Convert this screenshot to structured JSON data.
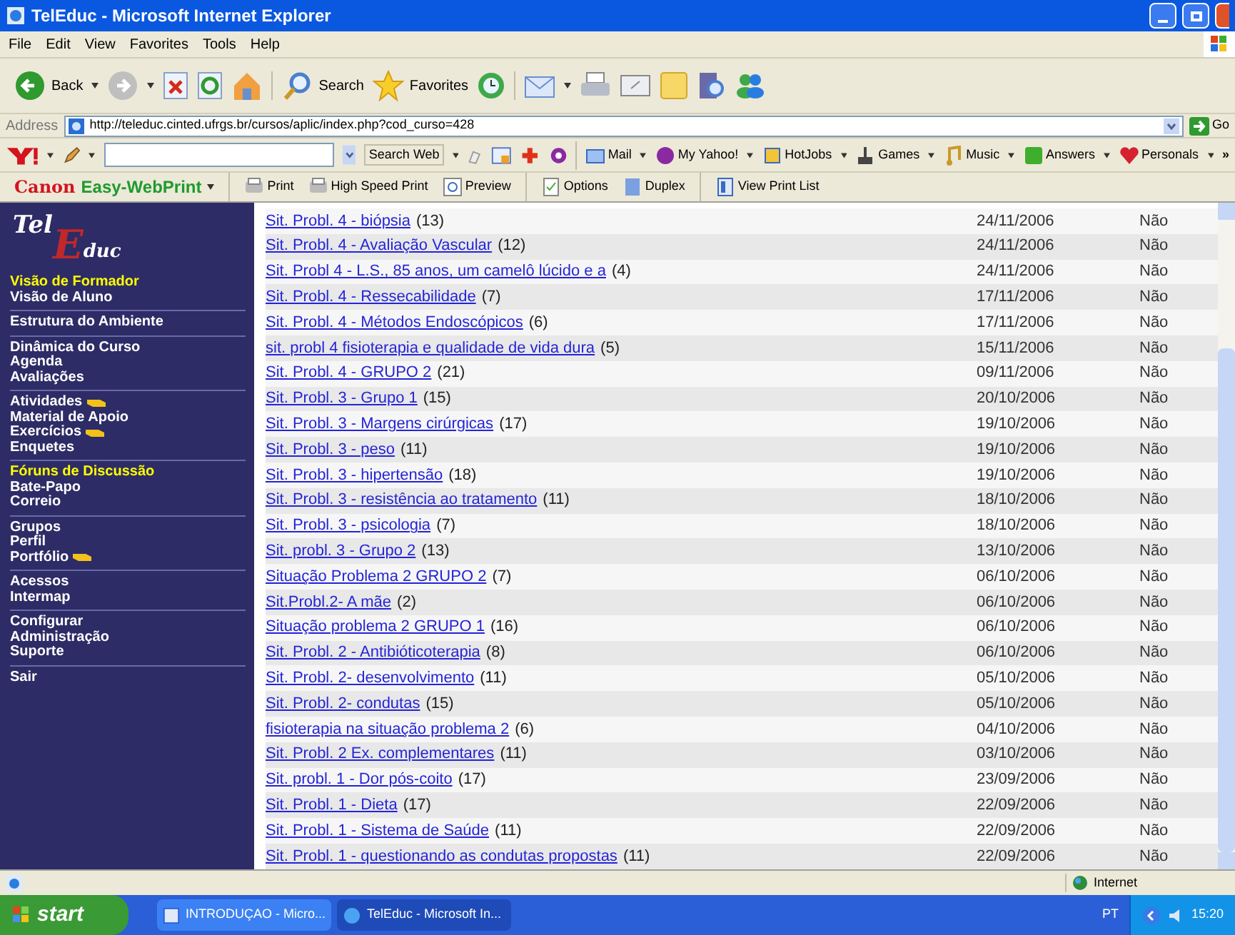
{
  "window": {
    "title": "TelEduc - Microsoft Internet Explorer"
  },
  "menu": [
    "File",
    "Edit",
    "View",
    "Favorites",
    "Tools",
    "Help"
  ],
  "toolbar": {
    "back": "Back",
    "search": "Search",
    "favorites": "Favorites"
  },
  "address": {
    "label": "Address",
    "url": "http://teleduc.cinted.ufrgs.br/cursos/aplic/index.php?cod_curso=428",
    "go": "Go"
  },
  "yahoo_bar": {
    "search_button": "Search Web",
    "items": [
      "Mail",
      "My Yahoo!",
      "HotJobs",
      "Games",
      "Music",
      "Answers",
      "Personals"
    ],
    "more": "»"
  },
  "print_bar": {
    "brand": "Canon",
    "product": "Easy-WebPrint",
    "items": [
      "Print",
      "High Speed Print",
      "Preview",
      "Options",
      "Duplex",
      "View Print List"
    ]
  },
  "sidebar": {
    "logo": [
      "Tel",
      "E",
      "duc"
    ],
    "groups": [
      [
        {
          "label": "Visão de Formador",
          "highlighted": true,
          "pointer": false
        },
        {
          "label": "Visão de Aluno",
          "highlighted": false,
          "pointer": false
        }
      ],
      [
        {
          "label": "Estrutura do Ambiente",
          "highlighted": false,
          "pointer": false
        }
      ],
      [
        {
          "label": "Dinâmica do Curso",
          "highlighted": false,
          "pointer": false
        },
        {
          "label": "Agenda",
          "highlighted": false,
          "pointer": false
        },
        {
          "label": "Avaliações",
          "highlighted": false,
          "pointer": false
        }
      ],
      [
        {
          "label": "Atividades",
          "highlighted": false,
          "pointer": true
        },
        {
          "label": "Material de Apoio",
          "highlighted": false,
          "pointer": false
        },
        {
          "label": "Exercícios",
          "highlighted": false,
          "pointer": true
        },
        {
          "label": "Enquetes",
          "highlighted": false,
          "pointer": false
        }
      ],
      [
        {
          "label": "Fóruns de Discussão",
          "highlighted": true,
          "pointer": false
        },
        {
          "label": "Bate-Papo",
          "highlighted": false,
          "pointer": false
        },
        {
          "label": "Correio",
          "highlighted": false,
          "pointer": false
        }
      ],
      [
        {
          "label": "Grupos",
          "highlighted": false,
          "pointer": false
        },
        {
          "label": "Perfil",
          "highlighted": false,
          "pointer": false
        },
        {
          "label": "Portfólio",
          "highlighted": false,
          "pointer": true
        }
      ],
      [
        {
          "label": "Acessos",
          "highlighted": false,
          "pointer": false
        },
        {
          "label": "Intermap",
          "highlighted": false,
          "pointer": false
        }
      ],
      [
        {
          "label": "Configurar",
          "highlighted": false,
          "pointer": false
        },
        {
          "label": "Administração",
          "highlighted": false,
          "pointer": false
        },
        {
          "label": "Suporte",
          "highlighted": false,
          "pointer": false
        }
      ],
      [
        {
          "label": "Sair",
          "highlighted": false,
          "pointer": false
        }
      ]
    ]
  },
  "forums": [
    {
      "title": "Sit. Probl. 4 - biópsia",
      "count": "(13)",
      "date": "24/11/2006",
      "status": "Não"
    },
    {
      "title": "Sit. Probl. 4 - Avaliação Vascular",
      "count": "(12)",
      "date": "24/11/2006",
      "status": "Não"
    },
    {
      "title": "Sit. Probl 4 - L.S., 85 anos, um camelô lúcido e a",
      "count": "(4)",
      "date": "24/11/2006",
      "status": "Não"
    },
    {
      "title": "Sit. Probl. 4 - Ressecabilidade",
      "count": "(7)",
      "date": "17/11/2006",
      "status": "Não"
    },
    {
      "title": "Sit. Probl. 4 - Métodos Endoscópicos",
      "count": "(6)",
      "date": "17/11/2006",
      "status": "Não"
    },
    {
      "title": "sit. probl 4 fisioterapia e qualidade de vida dura",
      "count": "(5)",
      "date": "15/11/2006",
      "status": "Não"
    },
    {
      "title": "Sit. Probl. 4 - GRUPO 2",
      "count": "(21)",
      "date": "09/11/2006",
      "status": "Não"
    },
    {
      "title": "Sit. Probl. 3 - Grupo 1",
      "count": "(15)",
      "date": "20/10/2006",
      "status": "Não"
    },
    {
      "title": "Sit. Probl. 3 - Margens cirúrgicas",
      "count": "(17)",
      "date": "19/10/2006",
      "status": "Não"
    },
    {
      "title": "Sit. Probl. 3 - peso",
      "count": "(11)",
      "date": "19/10/2006",
      "status": "Não"
    },
    {
      "title": "Sit. Probl. 3 - hipertensão",
      "count": "(18)",
      "date": "19/10/2006",
      "status": "Não"
    },
    {
      "title": "Sit. Probl. 3 - resistência ao tratamento",
      "count": "(11)",
      "date": "18/10/2006",
      "status": "Não"
    },
    {
      "title": "Sit. Probl. 3 - psicologia",
      "count": "(7)",
      "date": "18/10/2006",
      "status": "Não"
    },
    {
      "title": "Sit. probl. 3 - Grupo 2",
      "count": "(13)",
      "date": "13/10/2006",
      "status": "Não"
    },
    {
      "title": "Situação Problema 2 GRUPO 2",
      "count": "(7)",
      "date": "06/10/2006",
      "status": "Não"
    },
    {
      "title": "Sit.Probl.2- A mãe",
      "count": "(2)",
      "date": "06/10/2006",
      "status": "Não"
    },
    {
      "title": "Situação problema 2 GRUPO 1",
      "count": "(16)",
      "date": "06/10/2006",
      "status": "Não"
    },
    {
      "title": "Sit. Probl. 2 - Antibióticoterapia",
      "count": "(8)",
      "date": "06/10/2006",
      "status": "Não"
    },
    {
      "title": "Sit. Probl. 2- desenvolvimento",
      "count": "(11)",
      "date": "05/10/2006",
      "status": "Não"
    },
    {
      "title": "Sit. Probl. 2- condutas",
      "count": "(15)",
      "date": "05/10/2006",
      "status": "Não"
    },
    {
      "title": "fisioterapia na situação problema 2",
      "count": "(6)",
      "date": "04/10/2006",
      "status": "Não"
    },
    {
      "title": "Sit. Probl. 2 Ex. complementares",
      "count": "(11)",
      "date": "03/10/2006",
      "status": "Não"
    },
    {
      "title": "Sit. probl. 1 - Dor pós-coito",
      "count": "(17)",
      "date": "23/09/2006",
      "status": "Não"
    },
    {
      "title": "Sit. Probl. 1 - Dieta",
      "count": "(17)",
      "date": "22/09/2006",
      "status": "Não"
    },
    {
      "title": "Sit. Probl. 1 - Sistema de Saúde",
      "count": "(11)",
      "date": "22/09/2006",
      "status": "Não"
    },
    {
      "title": "Sit. Probl. 1 - questionando as condutas propostas",
      "count": "(11)",
      "date": "22/09/2006",
      "status": "Não"
    }
  ],
  "status_bar": {
    "zone": "Internet"
  },
  "taskbar": {
    "start": "start",
    "tasks": [
      {
        "label": "INTRODUÇAO - Micro...",
        "selected": false
      },
      {
        "label": "TelEduc - Microsoft In...",
        "selected": true
      }
    ],
    "language": "PT",
    "clock": "15:20"
  }
}
